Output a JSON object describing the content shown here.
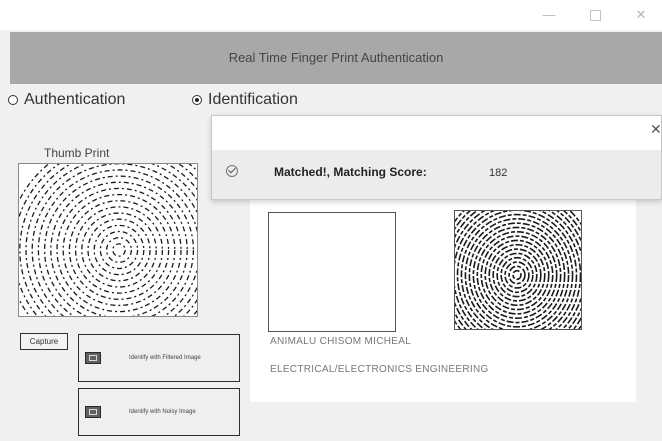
{
  "window": {
    "minimize_glyph": "—",
    "close_glyph": "✕"
  },
  "header": {
    "title": "Real Time Finger Print Authentication"
  },
  "modes": {
    "authentication": {
      "label": "Authentication",
      "selected": false
    },
    "identification": {
      "label": "Identification",
      "selected": true
    }
  },
  "left": {
    "thumb_label": "Thumb Print",
    "capture_label": "Capture",
    "identify_filtered_label": "Identify with Filtered Image",
    "identify_noisy_label": "Identify with Noisy Image"
  },
  "notification": {
    "close_glyph": "✕",
    "message": "Matched!, Matching Score:",
    "score": "182"
  },
  "result": {
    "name": "ANIMALU CHISOM MICHEAL",
    "department": "ELECTRICAL/ELECTRONICS ENGINEERING"
  },
  "colors": {
    "header_bg": "#a8a8a8",
    "window_bg": "#f0f0f0",
    "notification_body": "#ececec"
  }
}
